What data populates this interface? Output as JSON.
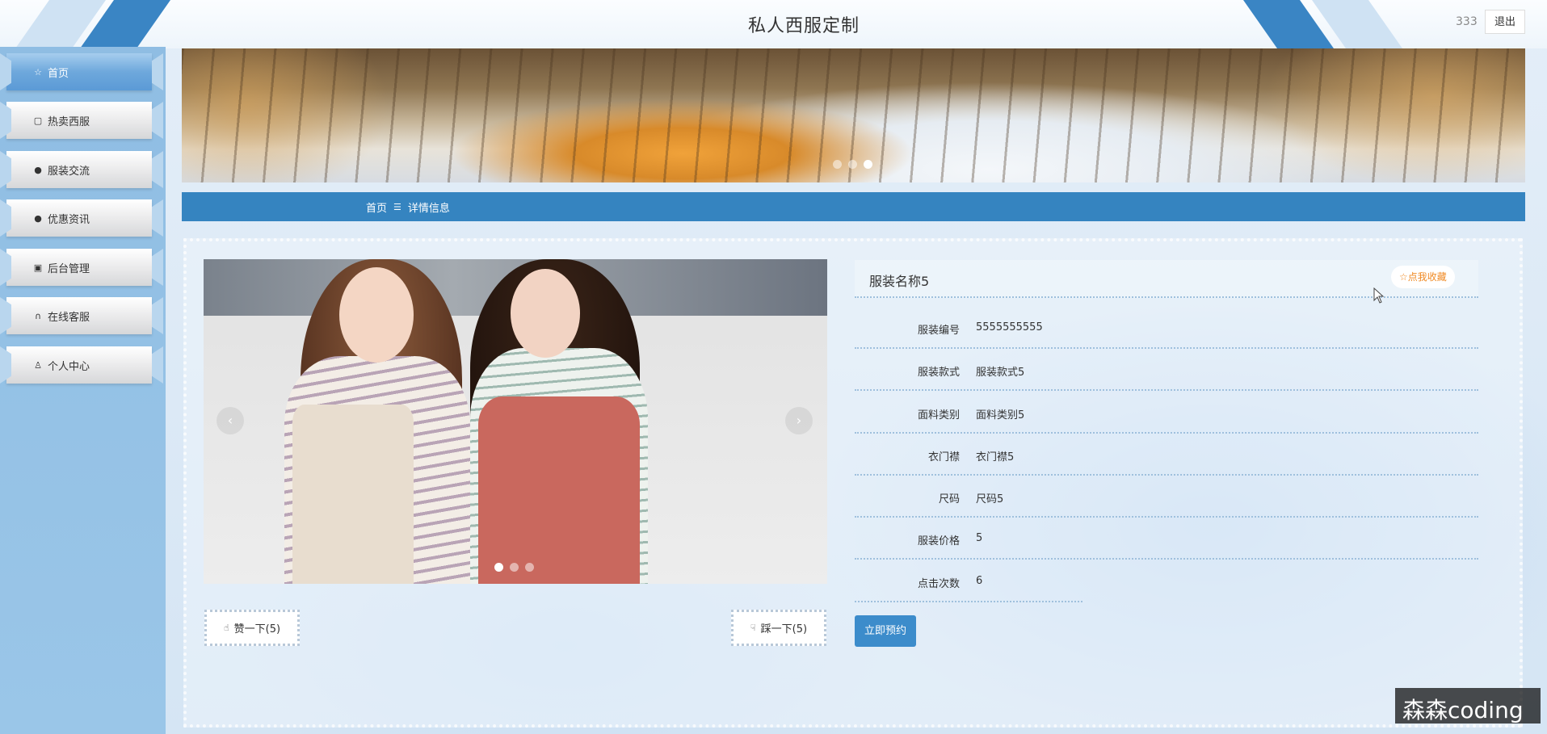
{
  "header": {
    "title": "私人西服定制",
    "user": "333",
    "logout_label": "退出"
  },
  "sidebar": {
    "items": [
      {
        "label": "首页",
        "icon": "home-icon",
        "active": true
      },
      {
        "label": "热卖西服",
        "icon": "bag-icon"
      },
      {
        "label": "服装交流",
        "icon": "alert-icon"
      },
      {
        "label": "优惠资讯",
        "icon": "question-icon"
      },
      {
        "label": "后台管理",
        "icon": "briefcase-icon"
      },
      {
        "label": "在线客服",
        "icon": "headset-icon"
      },
      {
        "label": "个人中心",
        "icon": "user-icon"
      }
    ]
  },
  "banner": {
    "slide_count": 3,
    "active_slide": 3
  },
  "breadcrumb": {
    "home": "首页",
    "separator": "☰",
    "current": "详情信息"
  },
  "gallery": {
    "slide_count": 3,
    "active_slide": 1,
    "prev_icon": "chevron-left-icon",
    "next_icon": "chevron-right-icon"
  },
  "votes": {
    "up_label": "赞一下(5)",
    "down_label": "踩一下(5)"
  },
  "detail": {
    "title": "服装名称5",
    "favorite_label": "☆点我收藏",
    "fields": [
      {
        "label": "服装编号",
        "value": "5555555555"
      },
      {
        "label": "服装款式",
        "value": "服装款式5"
      },
      {
        "label": "面料类别",
        "value": "面料类别5"
      },
      {
        "label": "衣门襟",
        "value": "衣门襟5"
      },
      {
        "label": "尺码",
        "value": "尺码5"
      },
      {
        "label": "服装价格",
        "value": "5"
      },
      {
        "label": "点击次数",
        "value": "6"
      }
    ],
    "reserve_label": "立即预约"
  },
  "watermark": "森森coding",
  "colors": {
    "primary": "#3584c0",
    "sidebar": "#8fbde3",
    "favorite": "#f08a24"
  }
}
